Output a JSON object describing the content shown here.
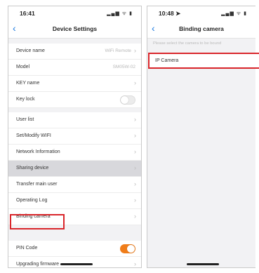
{
  "settings_screen": {
    "status": {
      "time": "16:41",
      "icons": "▂▄▆ ᯤ ▮"
    },
    "title": "Device Settings",
    "rows_group1": [
      {
        "label": "Device name",
        "value": "WiFi Remote",
        "chevron": true
      },
      {
        "label": "Model",
        "value": "SM05W-02",
        "chevron": false
      },
      {
        "label": "KEY name",
        "value": "",
        "chevron": true
      },
      {
        "label": "Key lock",
        "toggle": "off"
      }
    ],
    "rows_group2": [
      {
        "label": "User list",
        "chevron": true
      },
      {
        "label": "Set/Modify WIFI",
        "chevron": true
      },
      {
        "label": "Network Information",
        "chevron": true
      },
      {
        "label": "Sharing device",
        "chevron": true,
        "shaded": true
      },
      {
        "label": "Transfer main user",
        "chevron": true
      },
      {
        "label": "Operating Log",
        "chevron": true
      },
      {
        "label": "Binding camera",
        "chevron": true,
        "highlighted": true
      }
    ],
    "rows_group3": [
      {
        "label": "PIN Code",
        "toggle": "on"
      },
      {
        "label": "Upgrading firmware",
        "chevron": true
      }
    ]
  },
  "binding_screen": {
    "status": {
      "time": "10:48 ➤",
      "icons": "▂▄▆ ᯤ ▮"
    },
    "title": "Binding camera",
    "hint": "Please select the camera to be bound",
    "rows": [
      {
        "label": "IP Camera",
        "highlighted": true
      }
    ]
  },
  "icons": {
    "back": "chevron-left-icon",
    "row_arrow": "chevron-right-icon"
  },
  "colors": {
    "back_blue": "#1e7be0",
    "toggle_on": "#f07d1a",
    "highlight_red": "#d9262b",
    "shaded_row": "#d8d8dc"
  },
  "glyphs": {
    "back": "‹",
    "chevron": "›"
  }
}
